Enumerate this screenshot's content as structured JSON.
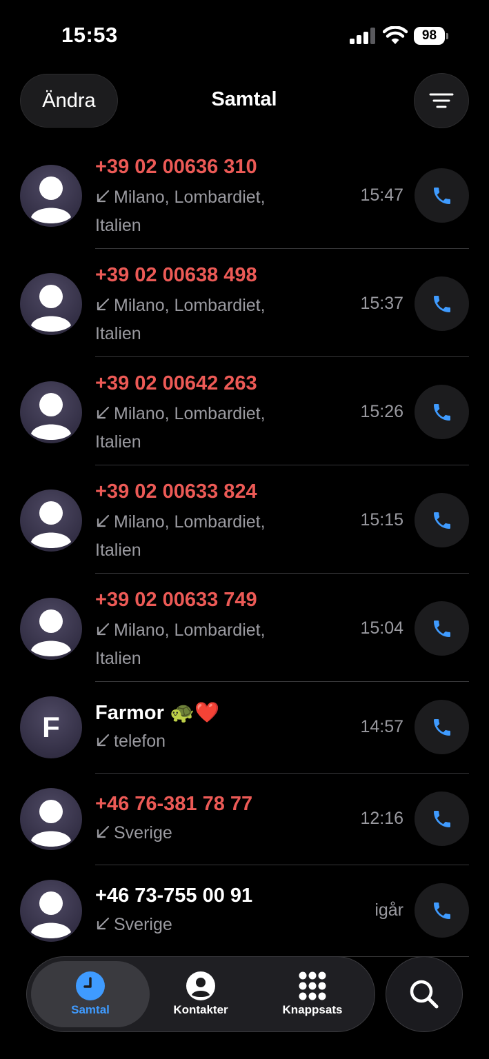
{
  "status_bar": {
    "time": "15:53",
    "battery": "98",
    "icons": [
      "cellular-signal-icon",
      "wifi-icon",
      "battery-icon"
    ]
  },
  "header": {
    "edit_label": "Ändra",
    "title": "Samtal",
    "filter_icon": "filter-lines-icon"
  },
  "colors": {
    "missed": "#ec5a56",
    "accent": "#3f9bff",
    "secondary_text": "#9a9aa0",
    "button_bg": "#1c1c1e"
  },
  "calls": [
    {
      "name": "+39 02 00636 310",
      "missed": true,
      "detail_line1": "Milano, Lombardiet,",
      "detail_line2": "Italien",
      "time": "15:47",
      "avatar": "person-icon"
    },
    {
      "name": "+39 02 00638 498",
      "missed": true,
      "detail_line1": "Milano, Lombardiet,",
      "detail_line2": "Italien",
      "time": "15:37",
      "avatar": "person-icon"
    },
    {
      "name": "+39 02 00642 263",
      "missed": true,
      "detail_line1": "Milano, Lombardiet,",
      "detail_line2": "Italien",
      "time": "15:26",
      "avatar": "person-icon"
    },
    {
      "name": "+39 02 00633 824",
      "missed": true,
      "detail_line1": "Milano, Lombardiet,",
      "detail_line2": "Italien",
      "time": "15:15",
      "avatar": "person-icon"
    },
    {
      "name": "+39 02 00633 749",
      "missed": true,
      "detail_line1": "Milano, Lombardiet,",
      "detail_line2": "Italien",
      "time": "15:04",
      "avatar": "person-icon"
    },
    {
      "name": "Farmor 🐢❤️",
      "missed": false,
      "detail_line1": "telefon",
      "time": "14:57",
      "avatar_letter": "F"
    },
    {
      "name": "+46 76-381 78 77",
      "missed": true,
      "detail_line1": "Sverige",
      "time": "12:16",
      "avatar": "person-icon"
    },
    {
      "name": "+46 73-755 00 91",
      "missed": false,
      "detail_line1": "Sverige",
      "time": "igår",
      "avatar": "person-icon"
    }
  ],
  "tabs": [
    {
      "label": "Samtal",
      "icon": "clock-icon",
      "active": true
    },
    {
      "label": "Kontakter",
      "icon": "person-circle-icon",
      "active": false
    },
    {
      "label": "Knappsats",
      "icon": "keypad-icon",
      "active": false
    }
  ],
  "search_icon": "search-icon"
}
